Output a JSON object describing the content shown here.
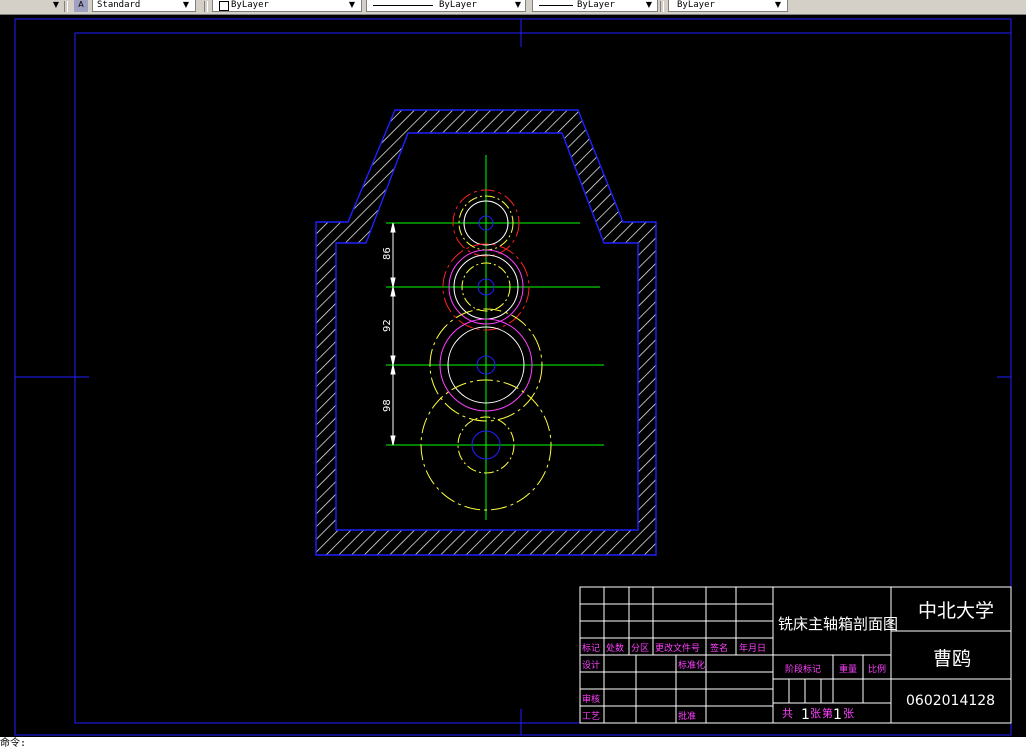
{
  "toolbar": {
    "text_style": "Standard",
    "layer": "ByLayer",
    "linetype": "ByLayer",
    "lineweight": "ByLayer",
    "plotstyle": "ByLayer"
  },
  "drawing": {
    "dimensions": [
      "86",
      "92",
      "98"
    ]
  },
  "title_block": {
    "drawing_title": "铣床主轴箱剖面图",
    "school": "中北大学",
    "author": "曹鸥",
    "student_id": "0602014128",
    "labels": {
      "mark": "标记",
      "count": "处数",
      "zone": "分区",
      "change_doc": "更改文件号",
      "signature": "签名",
      "date": "年月日",
      "design": "设计",
      "standardization": "标准化",
      "review": "审核",
      "process": "工艺",
      "approve": "批准",
      "stage_mark": "阶段标记",
      "weight": "重量",
      "scale": "比例",
      "total": "共",
      "sheet_unit": "张",
      "sheet_no": "第"
    },
    "total_sheets": "1",
    "sheet_number": "1"
  },
  "command_line": {
    "text": "命令:"
  }
}
